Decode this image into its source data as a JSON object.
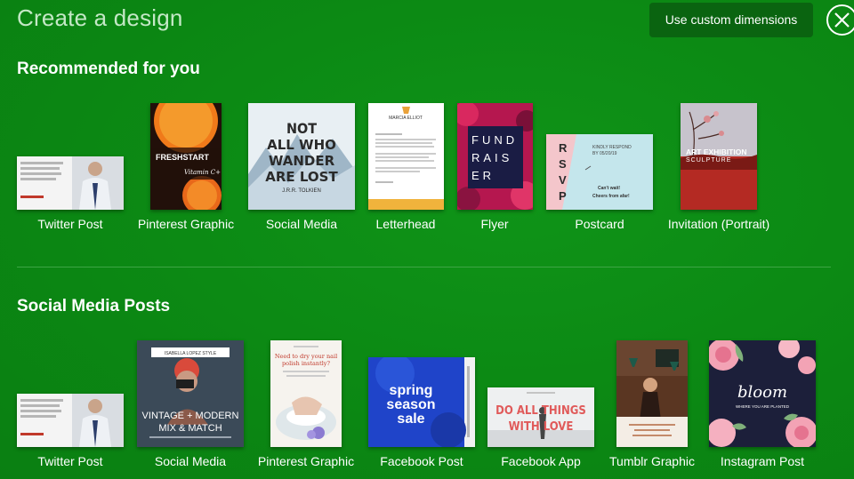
{
  "header": {
    "title": "Create a design",
    "custom_dimensions_label": "Use custom dimensions",
    "close_icon": "close-icon"
  },
  "recommended": {
    "title": "Recommended for you",
    "items": [
      {
        "label": "Twitter Post",
        "thumb_text": "What you get for achieving your goals is not as important as what you become by achieving your goals. LAWRENCE ADAM"
      },
      {
        "label": "Pinterest Graphic",
        "thumb_text": "FRESHSTART",
        "thumb_sub": "Vitamin C+"
      },
      {
        "label": "Social Media",
        "thumb_text": "NOT ALL WHO WANDER ARE LOST",
        "thumb_sub": "J.R.R. TOLKIEN"
      },
      {
        "label": "Letterhead",
        "thumb_text": "MARCIA ELLIOT"
      },
      {
        "label": "Flyer",
        "thumb_text": "FUND RAIS ER"
      },
      {
        "label": "Postcard",
        "thumb_text": "RSVP",
        "thumb_sub": "KINDLY RESPOND BY 05/20/19",
        "thumb_sub2": "Can't wait! Cheers from afar!"
      },
      {
        "label": "Invitation (Portrait)",
        "thumb_text": "ART EXHIBITION",
        "thumb_sub": "SCULPTURE"
      }
    ]
  },
  "social": {
    "title": "Social Media Posts",
    "items": [
      {
        "label": "Twitter Post",
        "thumb_text": "What you get for achieving your goals is not as important as what you become by achieving your goals. LAWRENCE ADAM"
      },
      {
        "label": "Social Media",
        "thumb_text": "VINTAGE + MODERN MIX & MATCH",
        "thumb_sub": "ISABELLA LOPEZ STYLE"
      },
      {
        "label": "Pinterest Graphic",
        "thumb_text": "Need to dry your nail polish instantly?"
      },
      {
        "label": "Facebook Post",
        "thumb_text": "spring season sale"
      },
      {
        "label": "Facebook App",
        "thumb_text": "DO ALL THINGS WITH LOVE"
      },
      {
        "label": "Tumblr Graphic",
        "thumb_text": ""
      },
      {
        "label": "Instagram Post",
        "thumb_text": "bloom",
        "thumb_sub": "WHERE YOU ARE PLANTED"
      }
    ]
  },
  "colors": {
    "background": "#0b8713",
    "button_bg": "#0a6410",
    "title_text": "#c4e8c6",
    "divider": "#3ea545"
  }
}
